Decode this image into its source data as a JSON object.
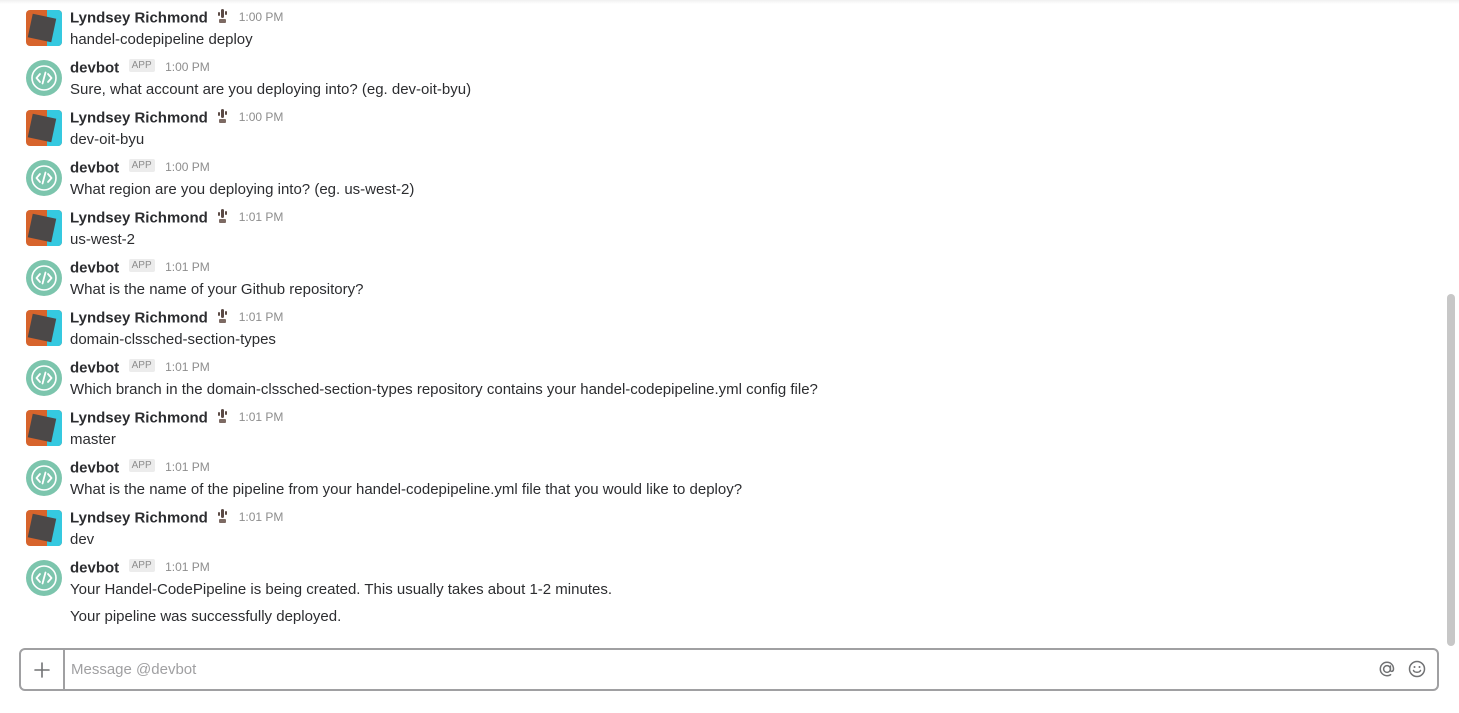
{
  "conversation": {
    "messages": [
      {
        "author": "Lyndsey Richmond",
        "type": "user",
        "time": "1:00 PM",
        "lines": [
          "handel-codepipeline deploy"
        ]
      },
      {
        "author": "devbot",
        "type": "bot",
        "badge": "APP",
        "time": "1:00 PM",
        "lines": [
          "Sure, what account are you deploying into? (eg. dev-oit-byu)"
        ]
      },
      {
        "author": "Lyndsey Richmond",
        "type": "user",
        "time": "1:00 PM",
        "lines": [
          "dev-oit-byu"
        ]
      },
      {
        "author": "devbot",
        "type": "bot",
        "badge": "APP",
        "time": "1:00 PM",
        "lines": [
          "What region are you deploying into? (eg. us-west-2)"
        ]
      },
      {
        "author": "Lyndsey Richmond",
        "type": "user",
        "time": "1:01 PM",
        "lines": [
          "us-west-2"
        ]
      },
      {
        "author": "devbot",
        "type": "bot",
        "badge": "APP",
        "time": "1:01 PM",
        "lines": [
          "What is the name of your Github repository?"
        ]
      },
      {
        "author": "Lyndsey Richmond",
        "type": "user",
        "time": "1:01 PM",
        "lines": [
          "domain-clssched-section-types"
        ]
      },
      {
        "author": "devbot",
        "type": "bot",
        "badge": "APP",
        "time": "1:01 PM",
        "lines": [
          "Which branch in the domain-clssched-section-types repository contains your handel-codepipeline.yml config file?"
        ]
      },
      {
        "author": "Lyndsey Richmond",
        "type": "user",
        "time": "1:01 PM",
        "lines": [
          "master"
        ]
      },
      {
        "author": "devbot",
        "type": "bot",
        "badge": "APP",
        "time": "1:01 PM",
        "lines": [
          "What is the name of the pipeline from your handel-codepipeline.yml file that you would like to deploy?"
        ]
      },
      {
        "author": "Lyndsey Richmond",
        "type": "user",
        "time": "1:01 PM",
        "lines": [
          "dev"
        ]
      },
      {
        "author": "devbot",
        "type": "bot",
        "badge": "APP",
        "time": "1:01 PM",
        "lines": [
          "Your Handel-CodePipeline is being created. This usually takes about 1-2 minutes.",
          "Your pipeline was successfully deployed."
        ]
      }
    ]
  },
  "composer": {
    "placeholder": "Message @devbot",
    "value": "",
    "plus_label": "+"
  },
  "icons": {
    "user_status": "cactus-icon",
    "bot_avatar": "code-icon",
    "mention": "at-sign-icon",
    "emoji": "smiley-icon",
    "add": "plus-icon"
  },
  "colors": {
    "bot_avatar": "#7cc5ad",
    "user_avatar_orange": "#d7642c",
    "user_avatar_cyan": "#35c9e0",
    "timestamp": "#8d8d8d"
  }
}
